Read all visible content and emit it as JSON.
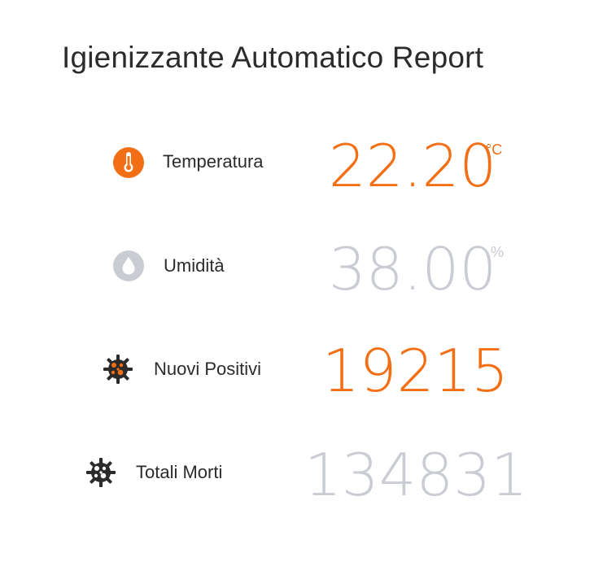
{
  "title": "Igienizzante Automatico Report",
  "colors": {
    "accent": "#F36F16",
    "muted": "#C9CCD3",
    "dark": "#2b2b2b"
  },
  "metrics": [
    {
      "label": "Temperatura",
      "value": "22.20",
      "unit": "°C",
      "icon": "thermometer-icon"
    },
    {
      "label": "Umidità",
      "value": "38.00",
      "unit": "%",
      "icon": "water-drop-icon"
    },
    {
      "label": "Nuovi Positivi",
      "value": "19215",
      "unit": "",
      "icon": "virus-icon"
    },
    {
      "label": "Totali Morti",
      "value": "134831",
      "unit": "",
      "icon": "virus-icon"
    }
  ]
}
